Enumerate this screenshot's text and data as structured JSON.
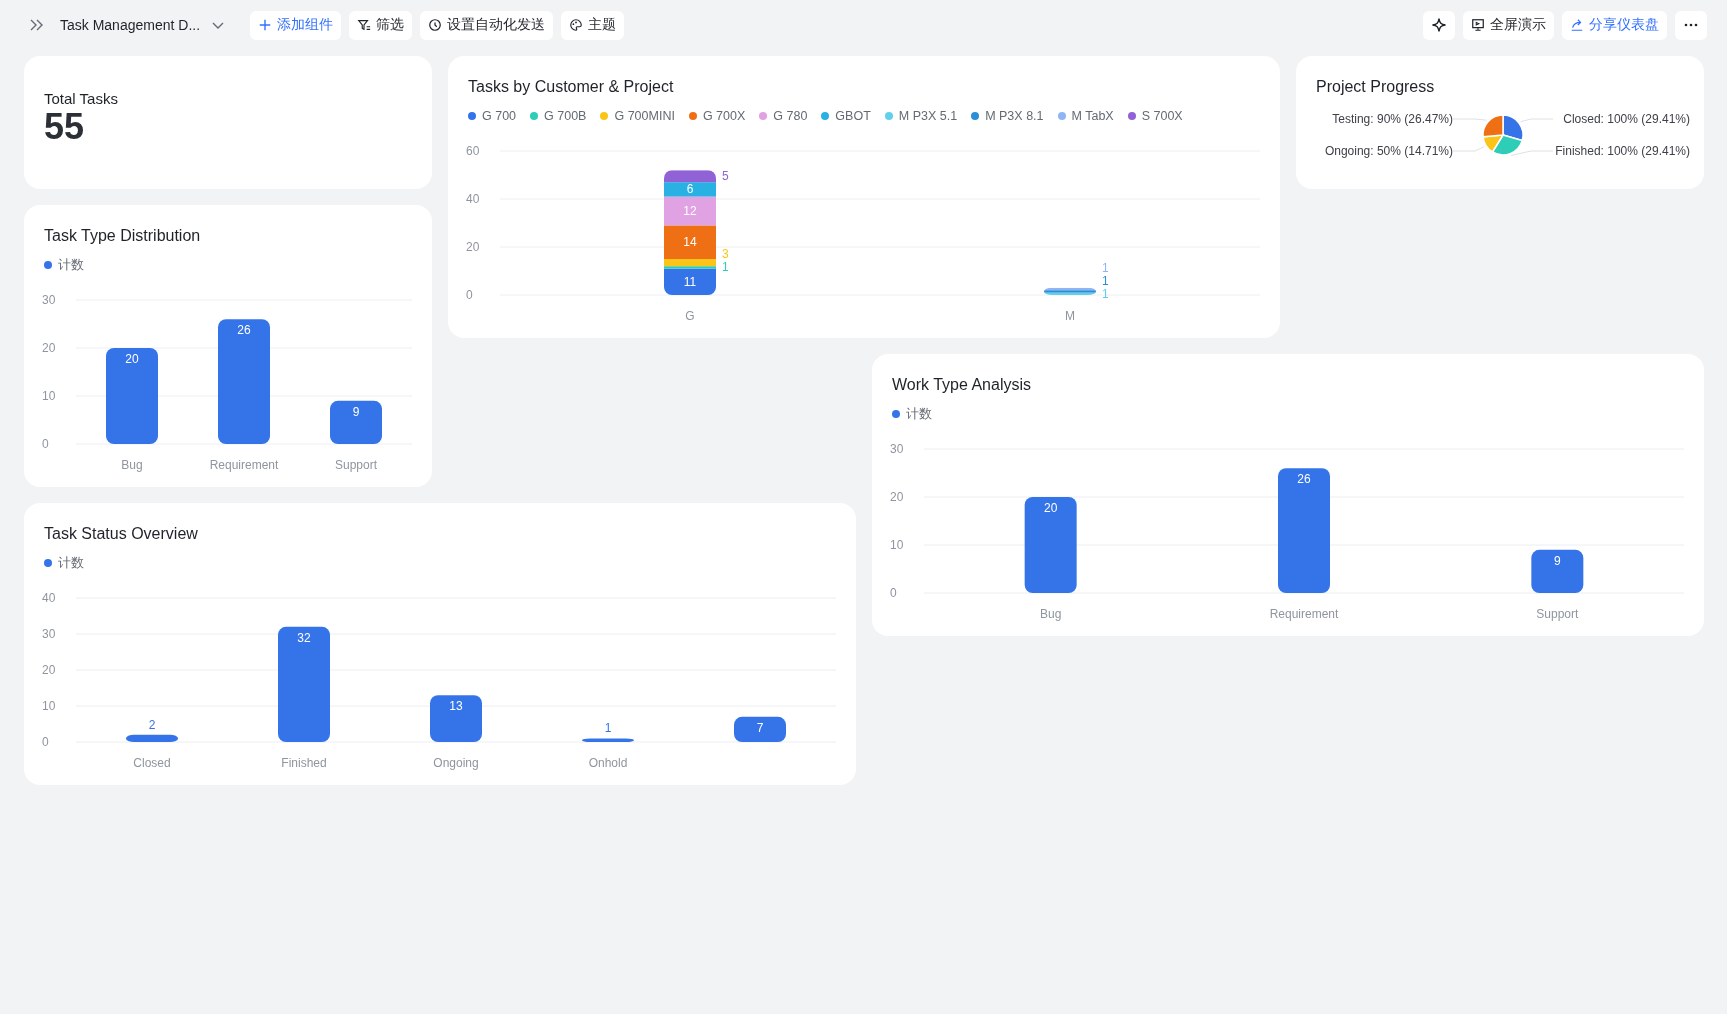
{
  "toolbar": {
    "title": "Task Management D...",
    "left_buttons": [
      {
        "kind": "add",
        "label": "添加组件",
        "primary": true
      },
      {
        "kind": "filter",
        "label": "筛选",
        "primary": false
      },
      {
        "kind": "schedule",
        "label": "设置自动化发送",
        "primary": false
      },
      {
        "kind": "theme",
        "label": "主题",
        "primary": false
      }
    ],
    "right_buttons": [
      {
        "kind": "sparkle",
        "primary": false
      },
      {
        "kind": "present",
        "label": "全屏演示",
        "primary": false
      },
      {
        "kind": "share",
        "label": "分享仪表盘",
        "primary": true
      },
      {
        "kind": "more",
        "primary": false
      }
    ]
  },
  "total_tasks": {
    "label": "Total Tasks",
    "value": "55"
  },
  "tasks_by_customer": {
    "title": "Tasks by Customer & Project",
    "chart_data": {
      "type": "bar",
      "stacked": true,
      "categories": [
        "G",
        "M"
      ],
      "grid": true,
      "yticks": [
        0,
        20,
        40,
        60
      ],
      "ylim": [
        0,
        60
      ],
      "data_labels": true,
      "series": [
        {
          "name": "G 700",
          "color": "#3574e8",
          "values": [
            11,
            null
          ]
        },
        {
          "name": "G 700B",
          "color": "#2ecdb8",
          "values": [
            1,
            null
          ]
        },
        {
          "name": "G 700MINI",
          "color": "#fac418",
          "values": [
            3,
            null
          ]
        },
        {
          "name": "G 700X",
          "color": "#ef7014",
          "values": [
            14,
            null
          ]
        },
        {
          "name": "G 780",
          "color": "#e0a2e2",
          "values": [
            12,
            null
          ]
        },
        {
          "name": "GBOT",
          "color": "#29b1e4",
          "values": [
            6,
            null
          ]
        },
        {
          "name": "M P3X 5.1",
          "color": "#62d0ea",
          "values": [
            null,
            1
          ]
        },
        {
          "name": "M P3X 8.1",
          "color": "#2b8fd8",
          "values": [
            null,
            1
          ]
        },
        {
          "name": "M TabX",
          "color": "#90b5f5",
          "values": [
            null,
            1
          ]
        },
        {
          "name": "S 700X",
          "color": "#9161d6",
          "values": [
            5,
            null
          ]
        }
      ]
    }
  },
  "project_progress": {
    "title": "Project Progress",
    "chart_data": {
      "type": "pie",
      "values": [
        29.41,
        29.41,
        14.71,
        26.47
      ],
      "value_labels": [
        "Closed: 100% (29.41%)",
        "Finished: 100% (29.41%)",
        "Ongoing: 50% (14.71%)",
        "Testing: 90% (26.47%)"
      ]
    }
  },
  "task_type_distribution": {
    "title": "Task Type Distribution",
    "chart_data": {
      "type": "bar",
      "grid": true,
      "categories": [
        "Bug",
        "Requirement",
        "Support"
      ],
      "yticks": [
        0,
        10,
        20,
        30
      ],
      "ylim": [
        0,
        30
      ],
      "data_labels": true,
      "series": [
        {
          "name": "计数",
          "color": "#3574e8",
          "values": [
            20,
            26,
            9
          ]
        }
      ]
    }
  },
  "work_type_analysis": {
    "title": "Work Type Analysis",
    "chart_data": {
      "type": "bar",
      "grid": true,
      "categories": [
        "Bug",
        "Requirement",
        "Support"
      ],
      "yticks": [
        0,
        10,
        20,
        30
      ],
      "ylim": [
        0,
        30
      ],
      "data_labels": true,
      "series": [
        {
          "name": "计数",
          "color": "#3574e8",
          "values": [
            20,
            26,
            9
          ]
        }
      ]
    }
  },
  "task_status_overview": {
    "title": "Task Status Overview",
    "chart_data": {
      "type": "bar",
      "grid": true,
      "categories": [
        "Closed",
        "Finished",
        "Ongoing",
        "Onhold",
        null
      ],
      "yticks": [
        0,
        10,
        20,
        30,
        40
      ],
      "ylim": [
        0,
        40
      ],
      "data_labels": true,
      "series": [
        {
          "name": "计数",
          "color": "#3574e8",
          "values": [
            2,
            32,
            13,
            1,
            7
          ]
        }
      ]
    }
  }
}
